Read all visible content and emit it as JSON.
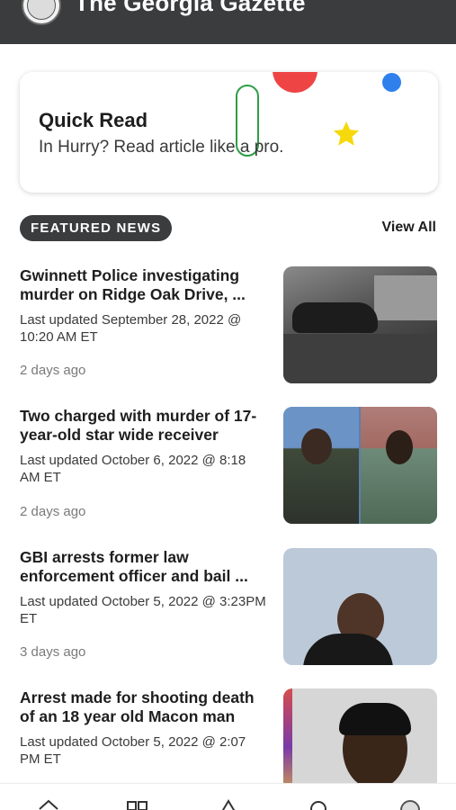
{
  "header": {
    "title": "The Georgia Gazette",
    "logo_icon": "newspaper-logo-icon"
  },
  "quick_read": {
    "title": "Quick Read",
    "subtitle": "In Hurry? Read article like a pro.",
    "colors": {
      "red": "#ef4444",
      "blue": "#2f80ed",
      "green": "#2e9e46",
      "yellow": "#f5d90a"
    }
  },
  "featured": {
    "label": "FEATURED NEWS",
    "view_all": "View All"
  },
  "news": [
    {
      "headline": "Gwinnett Police investigating murder on Ridge Oak Drive, ...",
      "updated": "Last updated September 28, 2022 @ 10:20 AM ET",
      "ago": "2 days ago"
    },
    {
      "headline": "Two charged with murder of 17-year-old star wide receiver",
      "updated": "Last updated October 6, 2022 @ 8:18 AM ET",
      "ago": "2 days ago"
    },
    {
      "headline": "GBI arrests former law enforcement officer and bail ...",
      "updated": "Last updated October 5, 2022 @ 3:23PM ET",
      "ago": "3 days ago"
    },
    {
      "headline": "Arrest made for shooting death of an 18 year old Macon man",
      "updated": "Last updated October 5, 2022 @ 2:07 PM ET",
      "ago": ""
    }
  ],
  "bottom_nav": {
    "icons": [
      "home-icon",
      "grid-icon",
      "alert-icon",
      "search-icon",
      "profile-icon"
    ]
  },
  "colors": {
    "header_bg": "#3b3c3e",
    "pill_bg": "#3b3c3e",
    "text": "#1e1e1e"
  }
}
